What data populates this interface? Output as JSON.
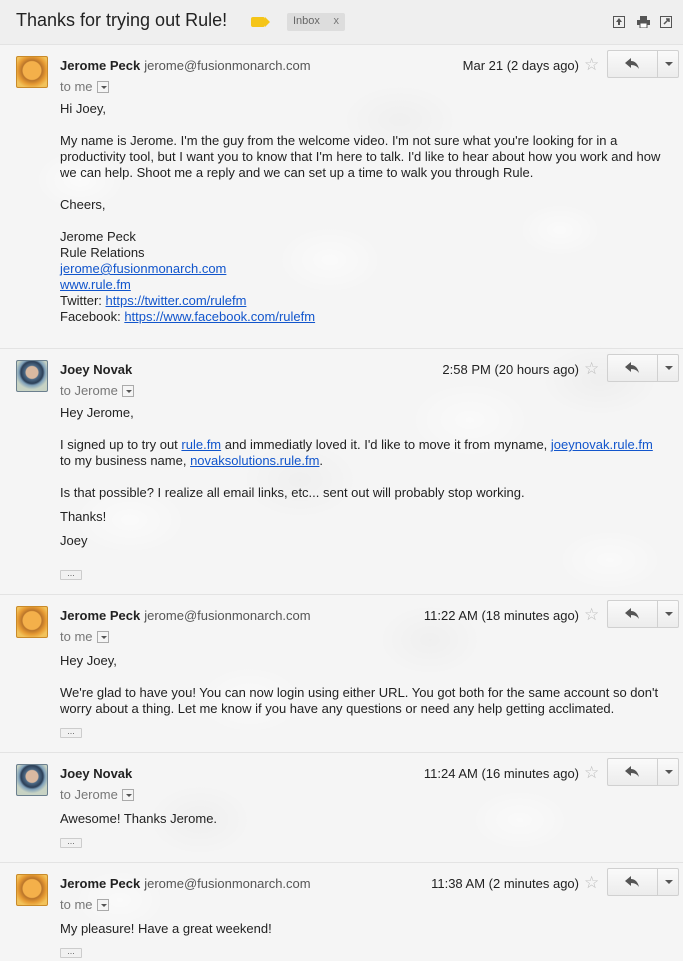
{
  "thread": {
    "subject": "Thanks for trying out Rule!",
    "label": "Inbox",
    "label_remove": "x"
  },
  "toolbar_icons": [
    "expand-all-icon",
    "print-icon",
    "new-window-icon"
  ],
  "messages": [
    {
      "sender_name": "Jerome Peck",
      "sender_email": "jerome@fusionmonarch.com",
      "to": "to me",
      "date": "Mar 21 (2 days ago)",
      "avatar": "jerome",
      "body": {
        "greeting": "Hi Joey,",
        "paragraph": "My name is Jerome. I'm the guy from the welcome video. I'm not sure what you're looking for in a productivity tool, but I want you to know that I'm here to talk. I'd like to hear about how you work and how we can help. Shoot me a reply and we can set up a time to walk you through Rule.",
        "closing": "Cheers,",
        "sig_name": "Jerome Peck",
        "sig_title": "Rule Relations",
        "sig_email": "jerome@fusionmonarch.com",
        "sig_web": "www.rule.fm",
        "sig_twitter_label": "Twitter:",
        "sig_twitter": "https://twitter.com/rulefm",
        "sig_facebook_label": "Facebook:",
        "sig_facebook": "https://www.facebook.com/rulefm"
      }
    },
    {
      "sender_name": "Joey Novak",
      "sender_email": "",
      "to": "to Jerome",
      "date": "2:58 PM (20 hours ago)",
      "avatar": "joey",
      "body": {
        "greeting": "Hey Jerome,",
        "p1_a": "I signed up to try out ",
        "p1_link1": "rule.fm",
        "p1_b": " and immediatly loved it.  I'd like to move it from myname, ",
        "p1_link2": "joeynovak.rule.fm",
        "p1_c": "to my business name, ",
        "p1_link3": "novaksolutions.rule.fm",
        "p1_d": ".",
        "p2": "Is that possible?  I realize all email links, etc... sent out will probably stop working.",
        "p3": "Thanks!",
        "p4": "Joey"
      }
    },
    {
      "sender_name": "Jerome Peck",
      "sender_email": "jerome@fusionmonarch.com",
      "to": "to me",
      "date": "11:22 AM (18 minutes ago)",
      "avatar": "jerome",
      "body": {
        "greeting": "Hey Joey,",
        "paragraph": "We're glad to have you! You can now login using either URL. You got both for the same account so don't worry about a thing. Let me know if you have any questions or need any help getting acclimated."
      }
    },
    {
      "sender_name": "Joey Novak",
      "sender_email": "",
      "to": "to Jerome",
      "date": "11:24 AM (16 minutes ago)",
      "avatar": "joey",
      "body": {
        "text": "Awesome!  Thanks Jerome."
      }
    },
    {
      "sender_name": "Jerome Peck",
      "sender_email": "jerome@fusionmonarch.com",
      "to": "to me",
      "date": "11:38 AM (2 minutes ago)",
      "avatar": "jerome",
      "body": {
        "text": "My pleasure! Have a great weekend!"
      }
    }
  ],
  "ui": {
    "star": "☆",
    "trimmed": "..."
  }
}
